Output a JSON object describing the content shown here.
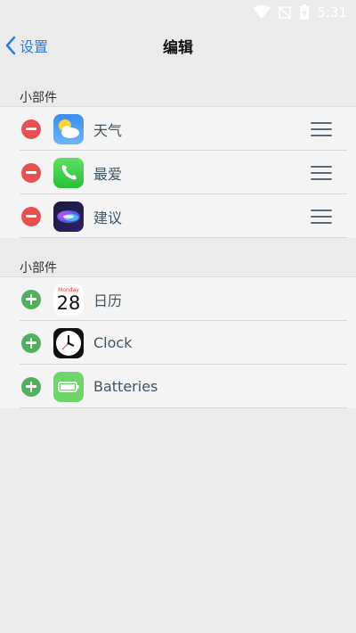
{
  "status_bar": {
    "time": "5:31"
  },
  "nav": {
    "back_label": "设置",
    "title": "编辑"
  },
  "sections": [
    {
      "header": "小部件",
      "items": [
        {
          "label": "天气",
          "icon": "weather-icon",
          "action": "remove"
        },
        {
          "label": "最爱",
          "icon": "phone-icon",
          "action": "remove"
        },
        {
          "label": "建议",
          "icon": "siri-icon",
          "action": "remove"
        }
      ]
    },
    {
      "header": "小部件",
      "items": [
        {
          "label": "日历",
          "icon": "calendar-icon",
          "action": "add",
          "icon_text": "Monday",
          "icon_number": "28"
        },
        {
          "label": "Clock",
          "icon": "clock-icon",
          "action": "add"
        },
        {
          "label": "Batteries",
          "icon": "battery-icon",
          "action": "add"
        }
      ]
    }
  ],
  "colors": {
    "accent": "#2a7de1",
    "remove": "#e85050",
    "add": "#4fb15a"
  }
}
